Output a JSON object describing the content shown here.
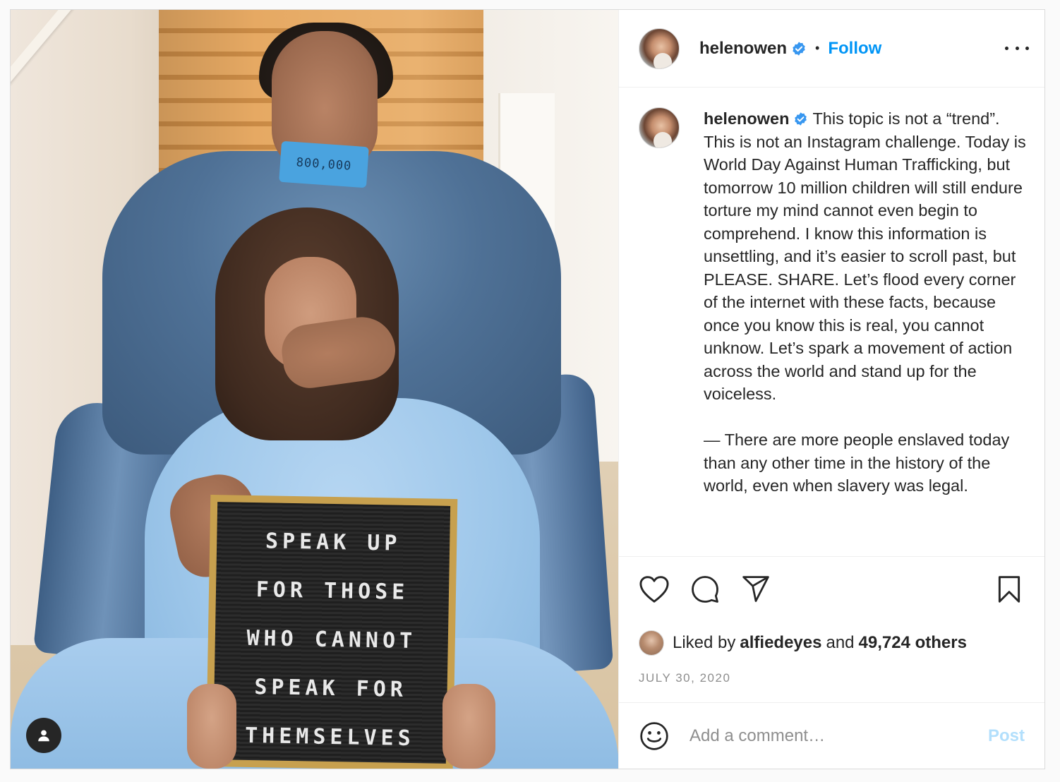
{
  "post": {
    "photo": {
      "tape_text": "800,000",
      "board_lines": [
        "SPEAK  UP",
        "FOR  THOSE",
        "WHO CANNOT",
        "SPEAK  FOR",
        "THEMSELVES"
      ],
      "tag_icon": "user-tag-icon"
    },
    "header": {
      "username": "helenowen",
      "separator": "•",
      "follow_label": "Follow",
      "verified_icon": "verified-badge-icon",
      "more_icon": "more-options-icon"
    },
    "caption": {
      "username": "helenowen",
      "paragraphs": [
        "This topic is not a “trend”. This is not an Instagram challenge. Today is World Day Against Human Trafficking, but tomorrow 10 million children will still endure torture my mind cannot even begin to comprehend. I know this information is unsettling, and it’s easier to scroll past, but PLEASE. SHARE. Let’s flood every corner of the internet with these facts, because once you know this is real, you cannot unknow. Let’s spark a movement of action across the world and stand up for the voiceless.",
        "— There are more people enslaved today than any other time in the history of the world, even when slavery was legal."
      ]
    },
    "actions": {
      "like_icon": "heart-icon",
      "comment_icon": "comment-icon",
      "share_icon": "share-icon",
      "save_icon": "bookmark-icon"
    },
    "likes": {
      "prefix": "Liked by",
      "liker": "alfiedeyes",
      "conjunction": "and",
      "others": "49,724 others"
    },
    "date": "JULY 30, 2020",
    "comment": {
      "placeholder": "Add a comment…",
      "post_label": "Post",
      "emoji_icon": "emoji-icon"
    },
    "colors": {
      "link_blue": "#0095f6",
      "post_disabled": "#b2dffc",
      "muted": "#8e8e8e",
      "border": "#dbdbdb"
    }
  }
}
